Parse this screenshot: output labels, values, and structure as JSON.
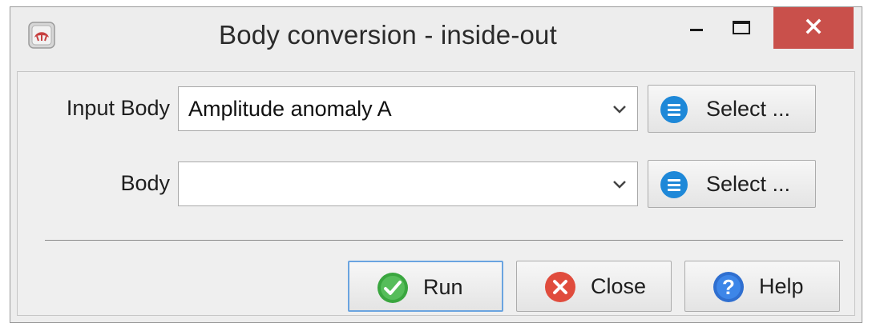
{
  "window": {
    "title": "Body conversion - inside-out"
  },
  "form": {
    "input_body": {
      "label": "Input Body",
      "value": "Amplitude anomaly A",
      "select_label": "Select ..."
    },
    "body": {
      "label": "Body",
      "value": "",
      "select_label": "Select ..."
    }
  },
  "actions": {
    "run_label": "Run",
    "close_label": "Close",
    "help_label": "Help"
  },
  "colors": {
    "close_titlebar_button": "#c9504b",
    "select_icon": "#1e88d8",
    "run_icon": "#3aa63f",
    "close_icon": "#e04c3d",
    "help_icon": "#2f6fd0",
    "focus_border": "#6aa4e0"
  },
  "icons": {
    "app": "app-icon",
    "minimize": "minimize-icon",
    "maximize": "maximize-icon",
    "close": "close-icon",
    "select": "list-icon",
    "run": "checkmark-icon",
    "close_action": "x-circle-icon",
    "help": "question-icon"
  }
}
